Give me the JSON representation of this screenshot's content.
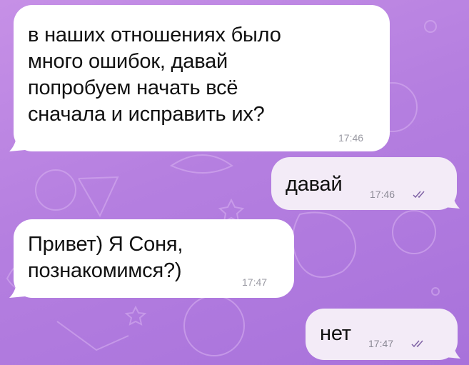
{
  "chat": {
    "messages": [
      {
        "direction": "incoming",
        "text": "в наших отношениях было\nмного ошибок, давай\nпопробуем начать всё\nсначала и исправить их?",
        "time": "17:46"
      },
      {
        "direction": "outgoing",
        "text": "давай",
        "time": "17:46",
        "status_icon": "double-check-icon"
      },
      {
        "direction": "incoming",
        "text": "Привет) Я Соня,\nпознакомимся?)",
        "time": "17:47"
      },
      {
        "direction": "outgoing",
        "text": "нет",
        "time": "17:47",
        "status_icon": "double-check-icon"
      }
    ]
  },
  "colors": {
    "background": "#b57fe0",
    "incoming_bubble": "#ffffff",
    "outgoing_bubble": "#f3ebf7",
    "check_color": "#7f62a6"
  }
}
